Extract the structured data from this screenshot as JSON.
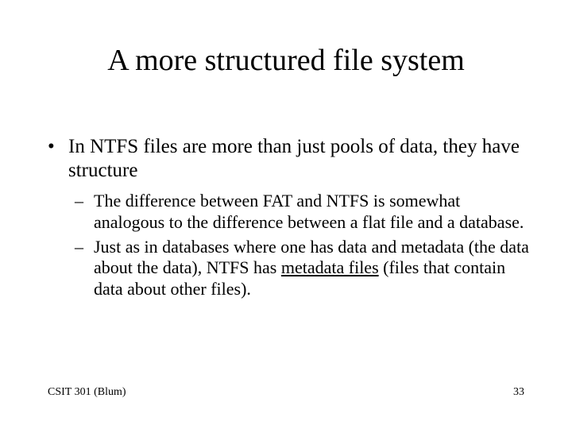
{
  "title": "A more structured file system",
  "body": {
    "item1": "In NTFS files are more than just pools of data, they have structure",
    "sub1": "The difference between FAT and NTFS is somewhat analogous to the difference between a flat file and a database.",
    "sub2_pre": "Just as in databases where one has data and metadata (the data about the data), NTFS has ",
    "sub2_u": "metadata files",
    "sub2_post": " (files that contain data about other files)."
  },
  "footer": {
    "left": "CSIT 301 (Blum)",
    "right": "33"
  }
}
